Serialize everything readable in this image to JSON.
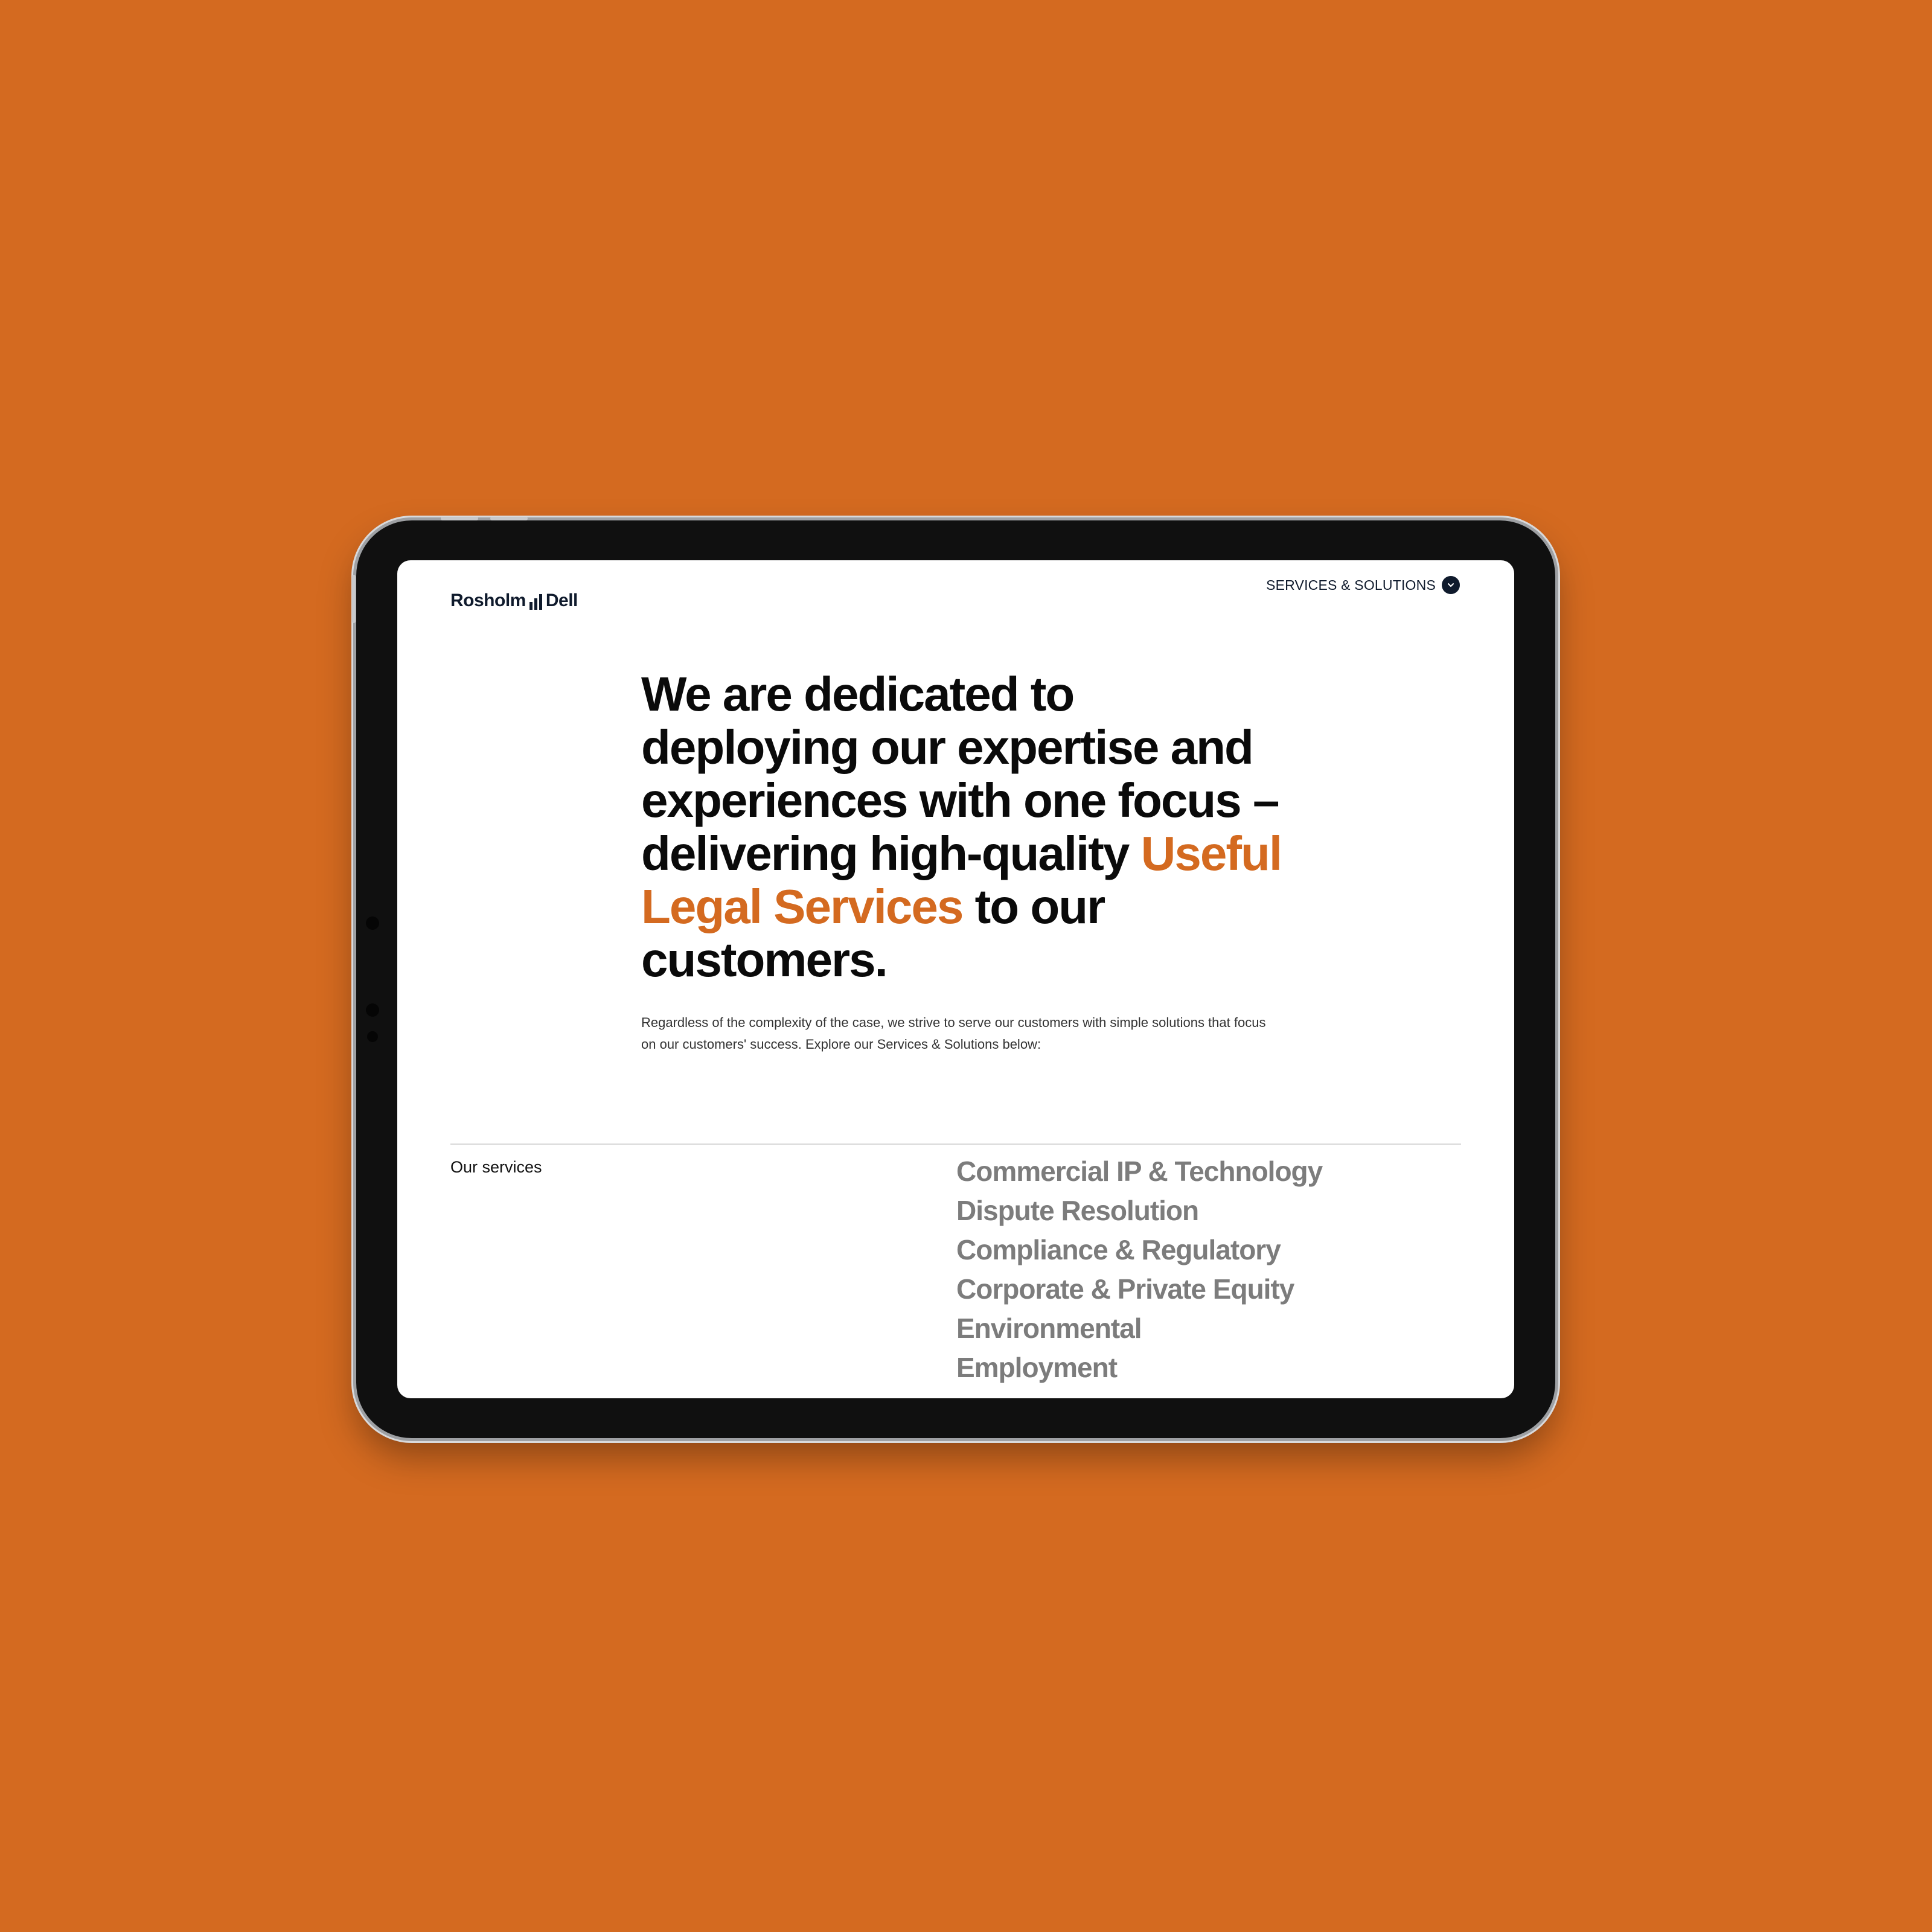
{
  "header": {
    "logo_left": "Rosholm",
    "logo_right": "Dell",
    "nav_label": "SERVICES & SOLUTIONS"
  },
  "hero": {
    "line_start": "We are dedicated to deploying our expertise and experiences with one focus – delivering high-quality",
    "accent": "Useful Legal Services",
    "line_end": "to our customers."
  },
  "intro": "Regardless of the complexity of the case, we strive to serve our customers with simple solutions that focus on our customers' success. Explore our Services & Solutions below:",
  "services": {
    "label": "Our services",
    "items": [
      "Commercial IP & Technology",
      "Dispute Resolution",
      "Compliance & Regulatory",
      "Corporate & Private Equity",
      "Environmental",
      "Employment"
    ]
  },
  "colors": {
    "background": "#d46a20",
    "accent": "#d46a20",
    "navy": "#0f1a2c",
    "service_gray": "#7c7c7c"
  },
  "icons": {
    "nav": "chevron-down-icon",
    "logo": "bar-chart-icon"
  }
}
